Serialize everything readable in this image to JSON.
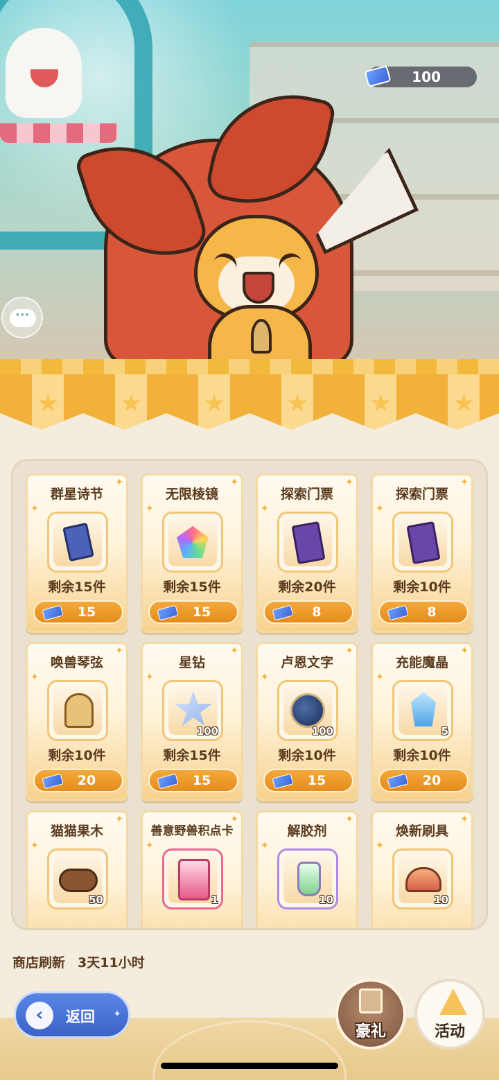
{
  "header": {
    "currency": {
      "icon": "ticket-icon",
      "amount": "100"
    },
    "chat_icon": "chat-icon"
  },
  "shop": {
    "items": [
      {
        "name": "群星诗节",
        "remaining": "剩余15件",
        "price": "15",
        "icon": "star-card-icon",
        "qty": ""
      },
      {
        "name": "无限棱镜",
        "remaining": "剩余15件",
        "price": "15",
        "icon": "prism-gem-icon",
        "qty": ""
      },
      {
        "name": "探索门票",
        "remaining": "剩余20件",
        "price": "8",
        "icon": "explore-ticket-icon",
        "qty": ""
      },
      {
        "name": "探索门票",
        "remaining": "剩余10件",
        "price": "8",
        "icon": "explore-ticket-icon",
        "qty": ""
      },
      {
        "name": "唤兽琴弦",
        "remaining": "剩余10件",
        "price": "20",
        "icon": "harp-icon",
        "qty": ""
      },
      {
        "name": "星钻",
        "remaining": "剩余15件",
        "price": "15",
        "icon": "star-diamond-icon",
        "qty": "100"
      },
      {
        "name": "卢恩文字",
        "remaining": "剩余10件",
        "price": "15",
        "icon": "rune-stone-icon",
        "qty": "100"
      },
      {
        "name": "充能魔晶",
        "remaining": "剩余10件",
        "price": "20",
        "icon": "magic-crystal-icon",
        "qty": "5"
      },
      {
        "name": "猫猫果木",
        "remaining": "",
        "price": "",
        "icon": "wood-log-icon",
        "qty": "50"
      },
      {
        "name": "善意野兽积点卡",
        "remaining": "",
        "price": "",
        "icon": "beast-point-card-icon",
        "qty": "1"
      },
      {
        "name": "解胶剂",
        "remaining": "",
        "price": "",
        "icon": "potion-bottle-icon",
        "qty": "10"
      },
      {
        "name": "焕新刷具",
        "remaining": "",
        "price": "",
        "icon": "brush-icon",
        "qty": "10"
      }
    ],
    "refresh_label": "商店刷新",
    "refresh_time": "3天11小时"
  },
  "footer": {
    "back_label": "返回",
    "gift_label": "豪礼",
    "event_label": "活动"
  }
}
